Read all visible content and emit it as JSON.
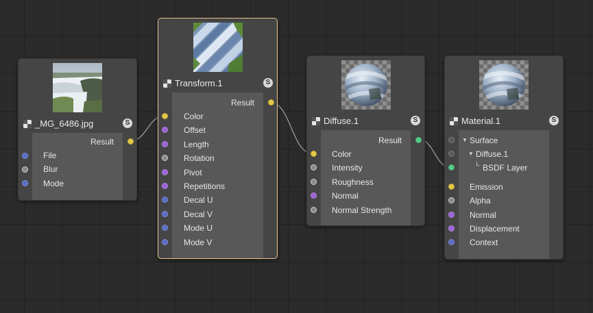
{
  "colors": {
    "canvas_bg": "#2b2b2b",
    "node_bg": "#454545",
    "panel_bg": "#585858",
    "selected_border": "#e8c58f",
    "wire": "#9a9a9a",
    "port_color_type": "#e3c84a",
    "port_vector": "#9b63d6",
    "port_integer": "#5b6dc0",
    "port_float": "#8a8a8a",
    "port_bsdf": "#58c98a"
  },
  "nodes": {
    "image": {
      "title": "_MG_6486.jpg",
      "s_label": "S",
      "output_label": "Result",
      "inputs": [
        {
          "label": "File",
          "port": "blue"
        },
        {
          "label": "Blur",
          "port": "gray"
        },
        {
          "label": "Mode",
          "port": "blue"
        }
      ]
    },
    "transform": {
      "title": "Transform.1",
      "s_label": "S",
      "output_label": "Result",
      "inputs": [
        {
          "label": "Color",
          "port": "yellow"
        },
        {
          "label": "Offset",
          "port": "purple"
        },
        {
          "label": "Length",
          "port": "purple"
        },
        {
          "label": "Rotation",
          "port": "gray"
        },
        {
          "label": "Pivot",
          "port": "purple"
        },
        {
          "label": "Repetitions",
          "port": "purple"
        },
        {
          "label": "Decal U",
          "port": "blue"
        },
        {
          "label": "Decal V",
          "port": "blue"
        },
        {
          "label": "Mode U",
          "port": "blue"
        },
        {
          "label": "Mode V",
          "port": "blue"
        }
      ]
    },
    "diffuse": {
      "title": "Diffuse.1",
      "s_label": "S",
      "output_label": "Result",
      "inputs": [
        {
          "label": "Color",
          "port": "yellow"
        },
        {
          "label": "Intensity",
          "port": "gray"
        },
        {
          "label": "Roughness",
          "port": "gray"
        },
        {
          "label": "Normal",
          "port": "purple"
        },
        {
          "label": "Normal Strength",
          "port": "gray"
        }
      ]
    },
    "material": {
      "title": "Material.1",
      "s_label": "S",
      "tree": [
        {
          "label": "Surface",
          "port": "dark"
        },
        {
          "label": "Diffuse.1",
          "port": "dark"
        },
        {
          "label": "BSDF Layer",
          "port": "green"
        }
      ],
      "inputs": [
        {
          "label": "Emission",
          "port": "yellow"
        },
        {
          "label": "Alpha",
          "port": "gray"
        },
        {
          "label": "Normal",
          "port": "purple"
        },
        {
          "label": "Displacement",
          "port": "purple"
        },
        {
          "label": "Context",
          "port": "blue"
        }
      ]
    }
  }
}
